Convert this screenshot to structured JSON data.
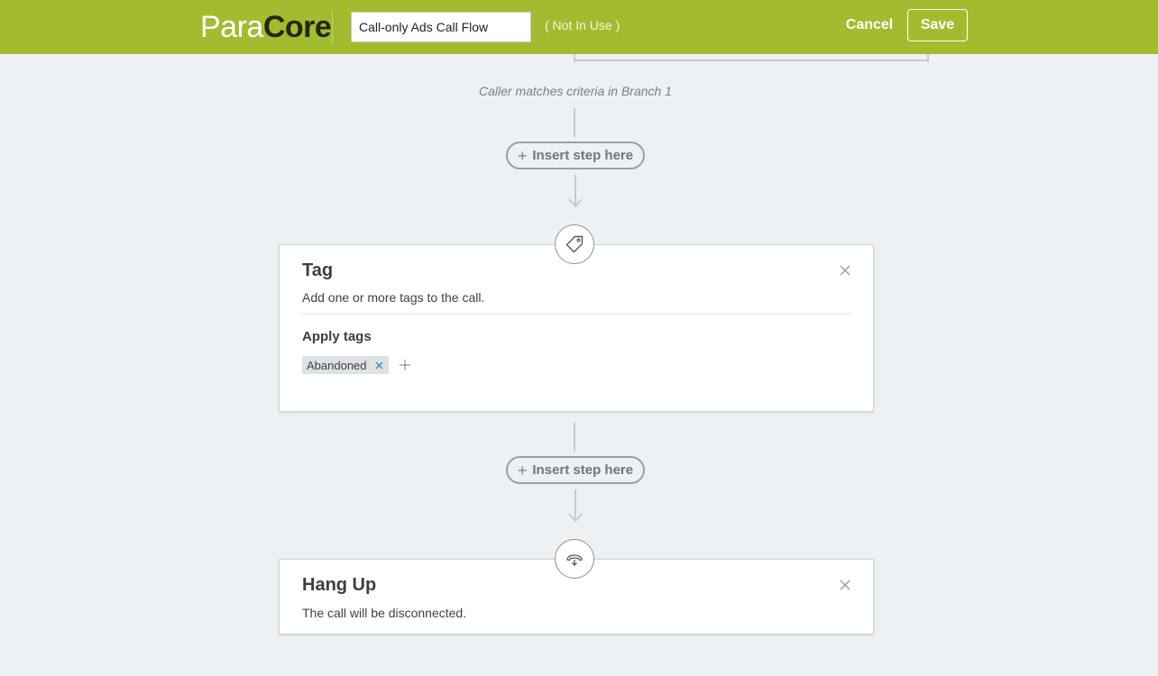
{
  "header": {
    "logo_light": "Para",
    "logo_bold": "Core",
    "flow_name": "Call-only Ads Call Flow",
    "status": "( Not In Use )",
    "cancel_label": "Cancel",
    "save_label": "Save"
  },
  "flow": {
    "branch_note": "Caller matches criteria in Branch 1",
    "insert_label": "Insert step here",
    "steps": [
      {
        "title": "Tag",
        "description": "Add one or more tags to the call.",
        "section_label": "Apply tags",
        "tags": [
          "Abandoned"
        ],
        "icon": "tag-icon"
      },
      {
        "title": "Hang Up",
        "description": "The call will be disconnected.",
        "icon": "hang-up-icon"
      }
    ]
  },
  "colors": {
    "header_bg": "#a3bb2f",
    "page_bg": "#eef1f3",
    "connector": "#c6cbcf"
  }
}
